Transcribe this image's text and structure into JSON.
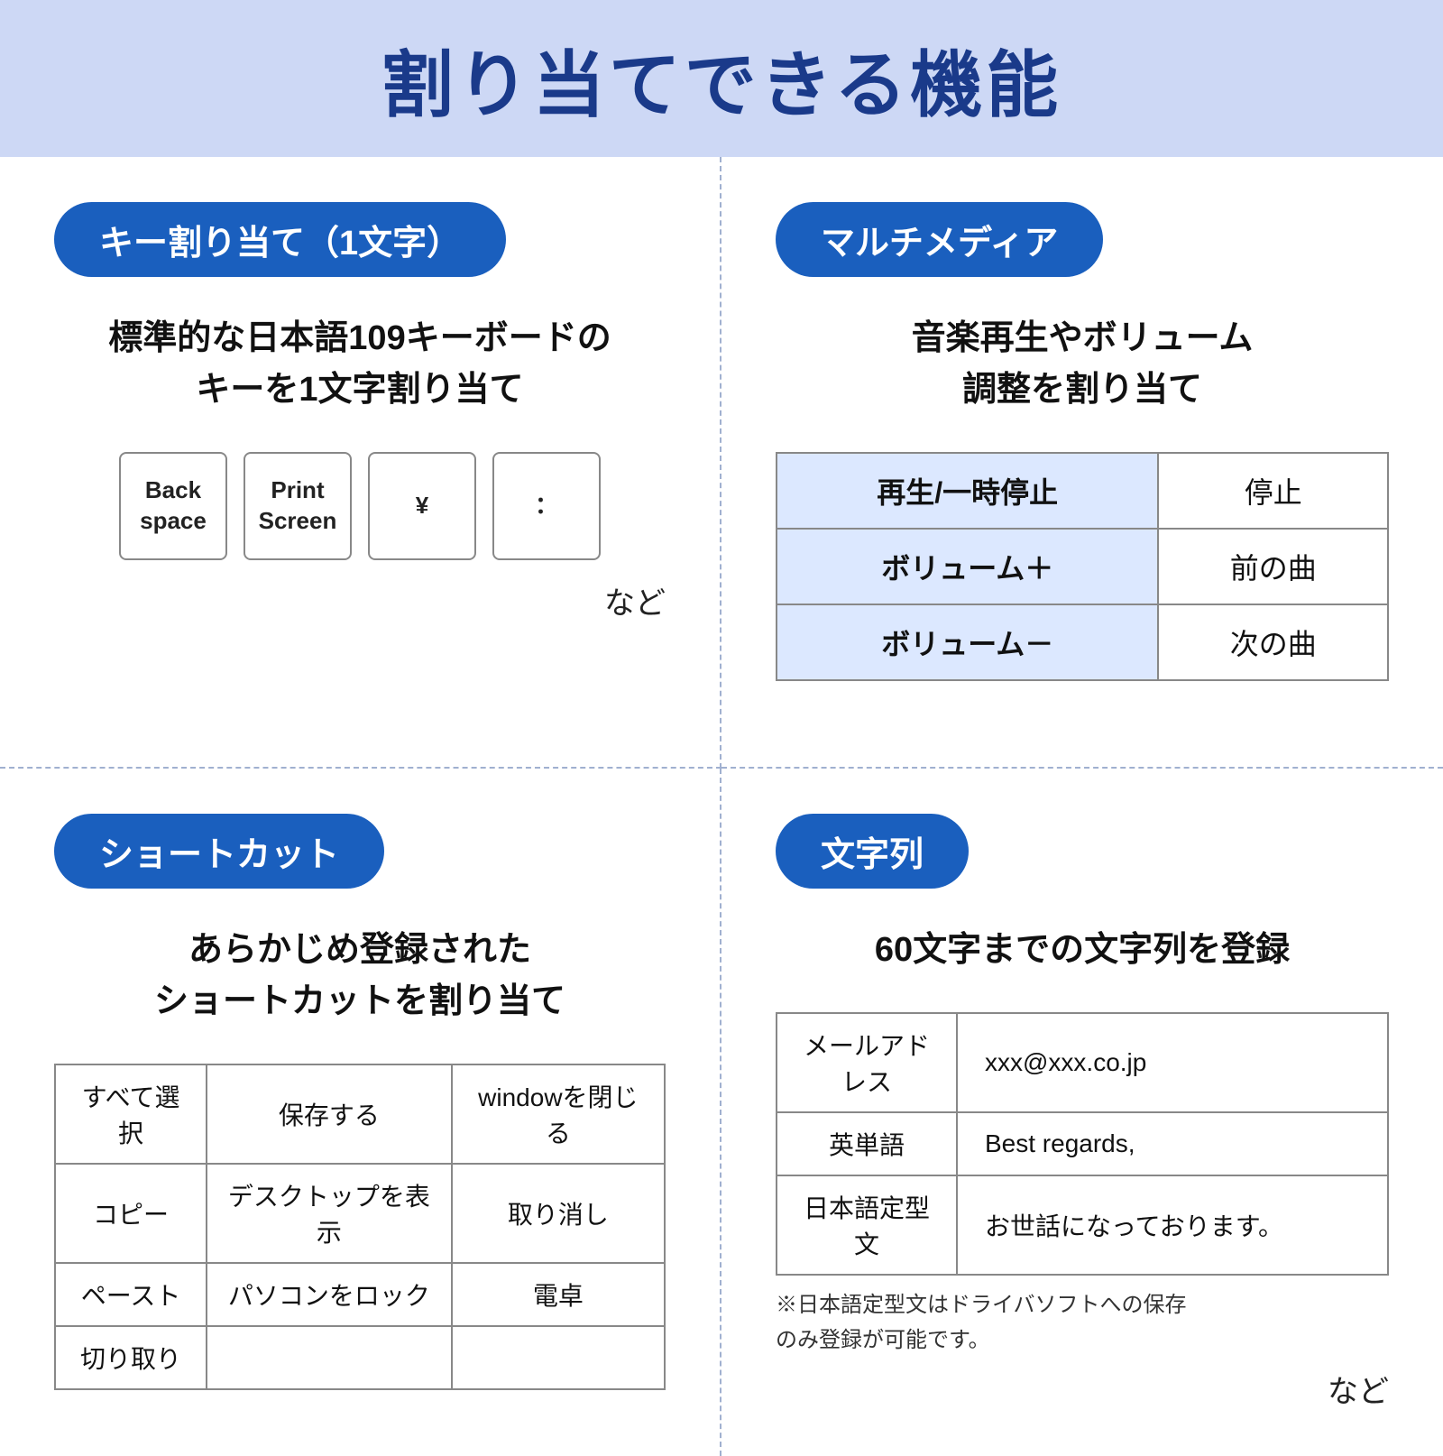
{
  "header": {
    "title": "割り当てできる機能"
  },
  "quadrant_tl": {
    "badge": "キー割り当て（1文字）",
    "description": "標準的な日本語109キーボードの\nキーを1文字割り当て",
    "keys": [
      {
        "line1": "Back",
        "line2": "space"
      },
      {
        "line1": "Print",
        "line2": "Screen"
      },
      {
        "line1": "¥",
        "line2": ""
      },
      {
        "line1": "：",
        "line2": ""
      }
    ],
    "nado": "など"
  },
  "quadrant_tr": {
    "badge": "マルチメディア",
    "description": "音楽再生やボリューム\n調整を割り当て",
    "table": {
      "rows": [
        [
          "再生/一時停止",
          "停止"
        ],
        [
          "ボリューム＋",
          "前の曲"
        ],
        [
          "ボリューム－",
          "次の曲"
        ]
      ]
    }
  },
  "quadrant_bl": {
    "badge": "ショートカット",
    "description": "あらかじめ登録された\nショートカットを割り当て",
    "table": {
      "rows": [
        [
          "すべて選択",
          "保存する",
          "windowを閉じる"
        ],
        [
          "コピー",
          "デスクトップを表示",
          "取り消し"
        ],
        [
          "ペースト",
          "パソコンをロック",
          "電卓"
        ],
        [
          "切り取り",
          "",
          ""
        ]
      ]
    }
  },
  "quadrant_br": {
    "badge": "文字列",
    "description": "60文字までの文字列を登録",
    "table": {
      "rows": [
        [
          "メールアドレス",
          "xxx@xxx.co.jp"
        ],
        [
          "英単語",
          "Best regards,"
        ],
        [
          "日本語定型文",
          "お世話になっております。"
        ]
      ]
    },
    "note": "※日本語定型文はドライバソフトへの保存\nのみ登録が可能です。",
    "nado": "など"
  }
}
